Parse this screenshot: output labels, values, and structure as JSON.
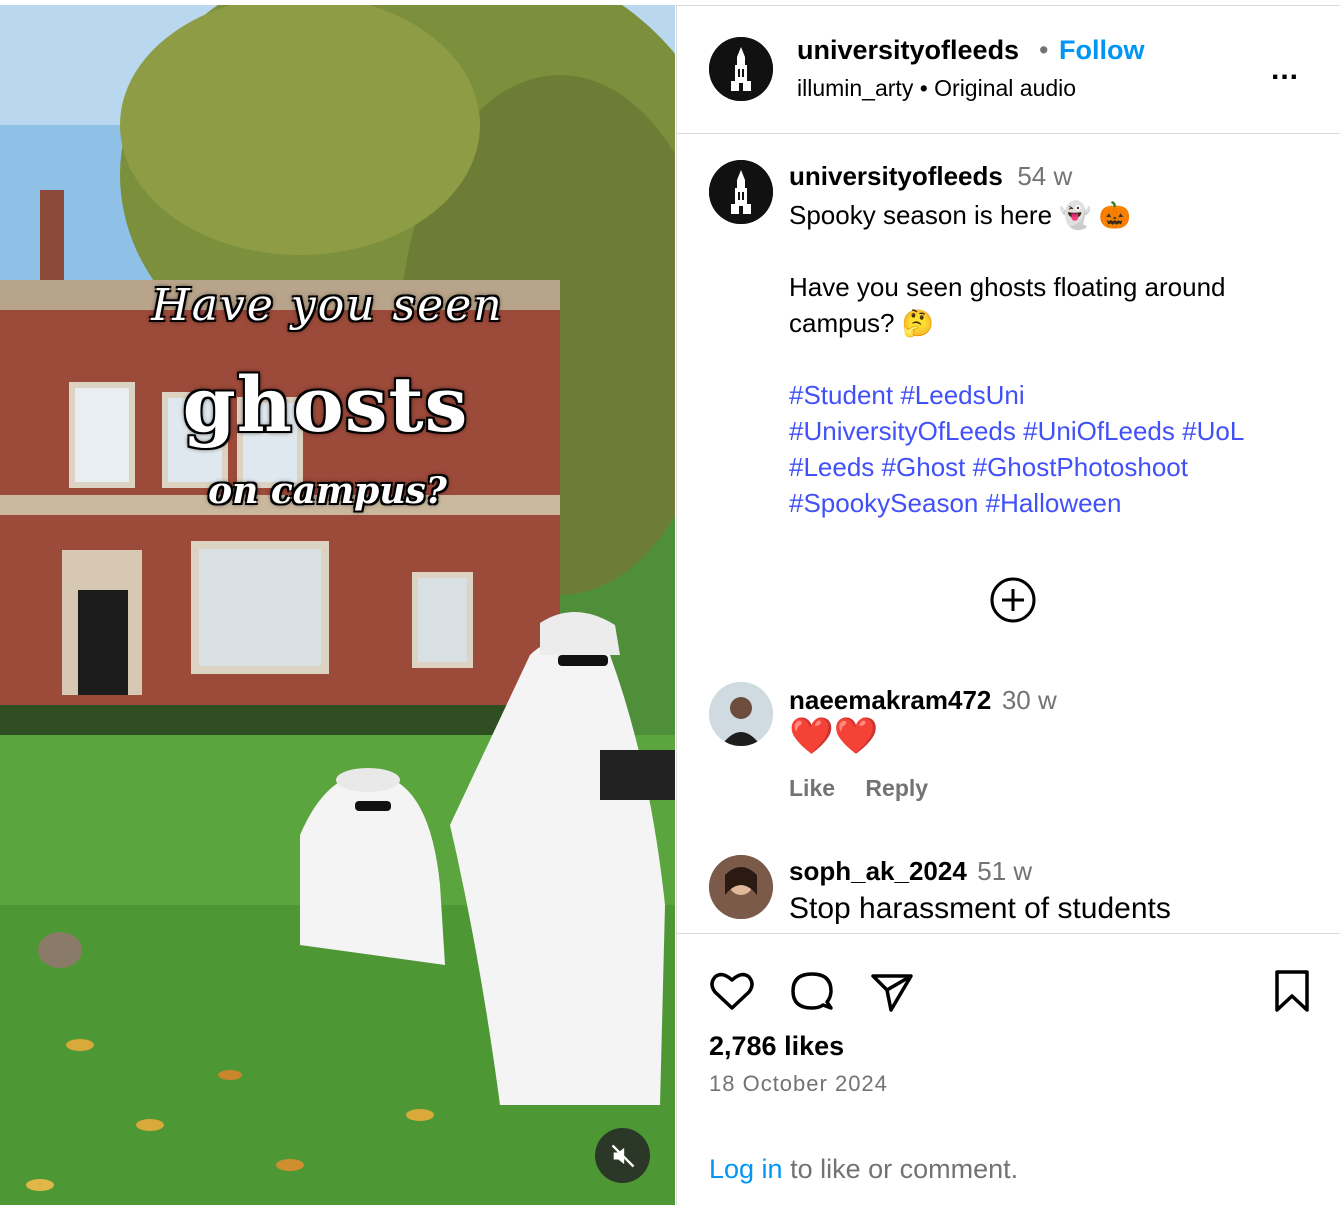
{
  "media": {
    "overlay_line1": "Have you seen",
    "overlay_line2": "ghosts",
    "overlay_line3": "on campus?",
    "mute_icon": "speaker-muted-icon"
  },
  "header": {
    "username": "universityofleeds",
    "separator": "•",
    "follow_label": "Follow",
    "subtitle": "illumin_arty • Original audio",
    "more_label": "..."
  },
  "caption": {
    "username": "universityofleeds",
    "age": "54 w",
    "lines": [
      "Spooky season is here 👻 🎃",
      "",
      "Have you seen ghosts floating around",
      "campus? 🤔"
    ],
    "hashtag_lines": [
      [
        "#Student",
        "#LeedsUni"
      ],
      [
        "#UniversityOfLeeds",
        "#UniOfLeeds",
        "#UoL"
      ],
      [
        "#Leeds",
        "#Ghost",
        "#GhostPhotoshoot"
      ],
      [
        "#SpookySeason",
        "#Halloween"
      ]
    ]
  },
  "comments": [
    {
      "username": "naeemakram472",
      "age": "30 w",
      "text": "❤️❤️",
      "like_label": "Like",
      "reply_label": "Reply"
    },
    {
      "username": "soph_ak_2024",
      "age": "51 w",
      "text": "Stop harassment of students"
    }
  ],
  "actions": {
    "icons": [
      "heart-icon",
      "comment-icon",
      "share-icon",
      "bookmark-icon"
    ],
    "likes": "2,786 likes",
    "date": "18 October 2024",
    "login_link": "Log in",
    "login_rest": " to like or comment."
  },
  "colors": {
    "link_blue": "#0095f6",
    "hashtag_blue": "#4150f7",
    "muted_gray": "#737373",
    "divider": "#dbdbdb"
  }
}
